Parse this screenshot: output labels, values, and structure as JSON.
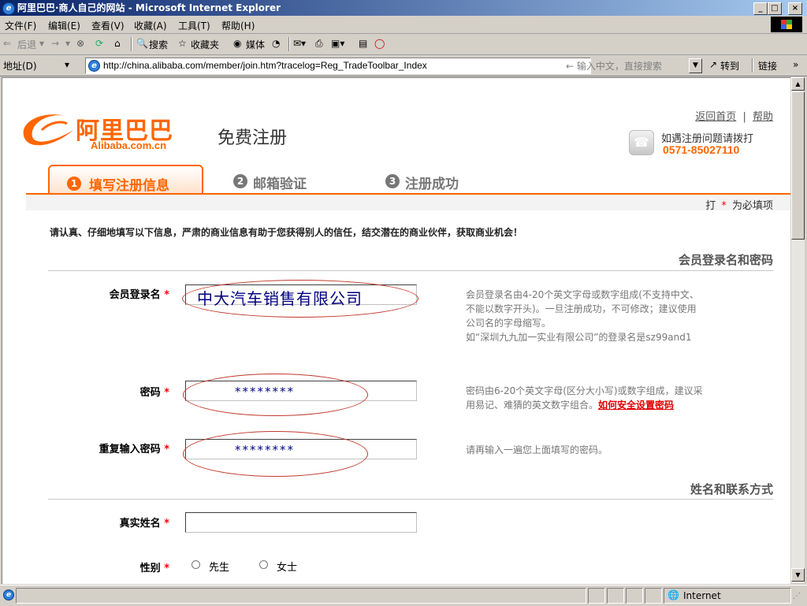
{
  "window": {
    "title": "阿里巴巴·商人自己的网站 - Microsoft Internet Explorer",
    "minimize": "_",
    "maximize": "□",
    "close": "×"
  },
  "menu": [
    "文件(F)",
    "编辑(E)",
    "查看(V)",
    "收藏(A)",
    "工具(T)",
    "帮助(H)"
  ],
  "toolbar": {
    "back": "后退",
    "forward": "→",
    "search": "搜索",
    "favorites": "收藏夹",
    "media": "媒体"
  },
  "address": {
    "label": "地址(D)",
    "url": "http://china.alibaba.com/member/join.htm?tracelog=Reg_TradeToolbar_Index",
    "search_hint": "← 输入中文，直接搜索",
    "go": "转到",
    "links": "链接"
  },
  "page": {
    "top_links": {
      "home": "返回首页",
      "sep": "|",
      "help": "帮助"
    },
    "logo_cn": "阿里巴巴",
    "logo_en": "Alibaba.com.cn",
    "heading": "免费注册",
    "hotline_text": "如遇注册问题请拨打",
    "hotline_number": "0571-85027110",
    "steps": [
      {
        "num": "1",
        "label": "填写注册信息"
      },
      {
        "num": "2",
        "label": "邮箱验证"
      },
      {
        "num": "3",
        "label": "注册成功"
      }
    ],
    "required_note_prefix": "打",
    "required_star": "*",
    "required_note_suffix": "为必填项",
    "intro": "请认真、仔细地填写以下信息，严肃的商业信息有助于您获得别人的信任，结交潜在的商业伙伴，获取商业机会！",
    "section_login": "会员登录名和密码",
    "section_contact": "姓名和联系方式",
    "fields": {
      "login_label": "会员登录名",
      "login_value": "中大汽车销售有限公司",
      "login_help": [
        "会员登录名由4-20个英文字母或数字组成(不支持中文、",
        "不能以数字开头)。一旦注册成功，不可修改；建议使用",
        "公司名的字母缩写。",
        "如“深圳九九加一实业有限公司”的登录名是sz99and1"
      ],
      "password_label": "密码",
      "password_value": "********",
      "password_help_1": "密码由6-20个英文字母(区分大小写)或数字组成，建议采",
      "password_help_2": "用易记、难猜的英文数字组合。",
      "password_help_link": "如何安全设置密码",
      "repeat_label": "重复输入密码",
      "repeat_value": "********",
      "repeat_help": "请再输入一遍您上面填写的密码。",
      "realname_label": "真实姓名",
      "gender_label": "性别",
      "gender_male": "先生",
      "gender_female": "女士"
    }
  },
  "status": {
    "zone": "Internet"
  },
  "colors": {
    "accent": "#ff6600",
    "titlebar": "#0a246a",
    "required": "#ff0000",
    "annotation": "#c0392b"
  }
}
